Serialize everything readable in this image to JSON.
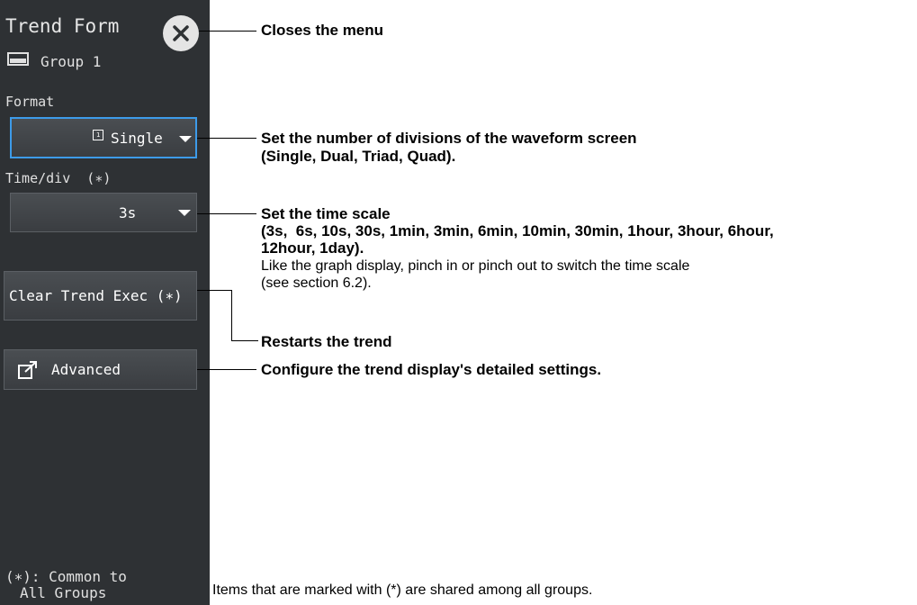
{
  "panel": {
    "title": "Trend Form",
    "group_label": "Group 1",
    "format_label": "Format",
    "format_value": "Single",
    "timediv_label": "Time/div  (∗)",
    "timediv_value": "3s",
    "clear_label": "Clear Trend Exec (∗)",
    "advanced_label": "Advanced",
    "footer_line1": "(∗): Common to",
    "footer_line2": "All Groups"
  },
  "callouts": {
    "close": "Closes the menu",
    "format_line1": "Set the number of divisions of the waveform screen",
    "format_line2": "(Single, Dual, Triad, Quad).",
    "timescale_line1": "Set the time scale",
    "timescale_line2": "(3s,  6s, 10s, 30s, 1min, 3min, 6min, 10min, 30min, 1hour, 3hour, 6hour,",
    "timescale_line3": "12hour, 1day).",
    "timescale_note1": "Like the graph display, pinch in or pinch out to switch the time scale",
    "timescale_note2": "(see section 6.2).",
    "restart": "Restarts the trend",
    "advanced": "Configure the trend display's detailed settings.",
    "footer": "Items that are marked with (*) are shared among all groups."
  },
  "colors": {
    "panel_bg": "#2e3134",
    "selected_border": "#3d9be9"
  }
}
